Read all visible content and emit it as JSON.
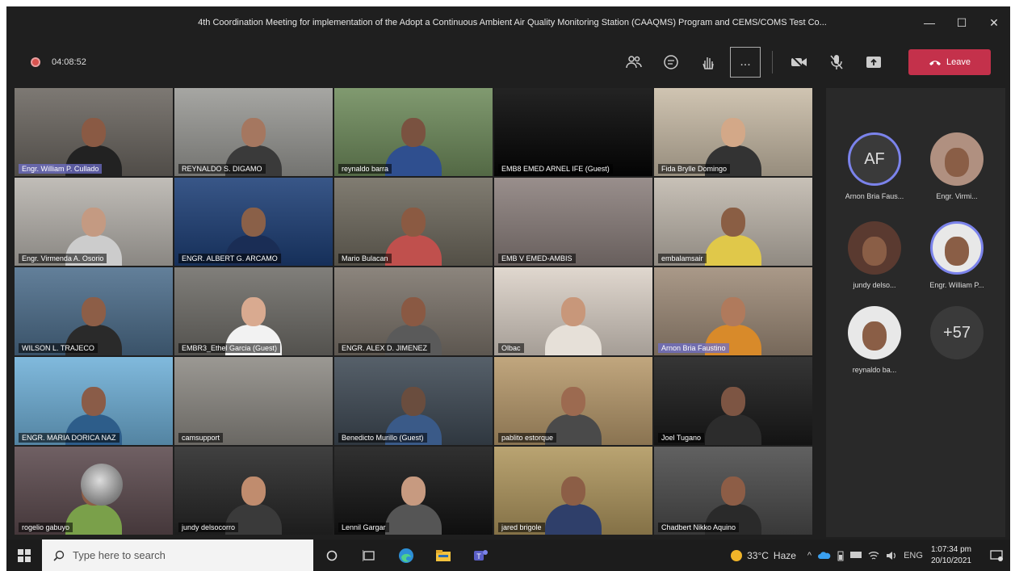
{
  "window": {
    "title": "4th Coordination Meeting for implementation of the Adopt a Continuous Ambient Air Quality Monitoring Station (CAAQMS) Program and CEMS/COMS Test Co...",
    "minimize": "—",
    "maximize": "☐",
    "close": "✕"
  },
  "toolbar": {
    "timer": "04:08:52",
    "more": "...",
    "leave_label": "Leave",
    "leave_color": "#c4314b"
  },
  "participants": [
    {
      "name": "Engr. William P. Cullado",
      "bg": "#6b6660",
      "skin": "#8a5a44",
      "shirt": "#222",
      "hl": true
    },
    {
      "name": "REYNALDO S. DIGAMO",
      "bg": "#9a9a96",
      "skin": "#a57760",
      "shirt": "#3a3a3a",
      "hl": false
    },
    {
      "name": "reynaldo barra",
      "bg": "#6f8c5c",
      "skin": "#7a5240",
      "shirt": "#2f4f8f",
      "hl": false
    },
    {
      "name": "EMB8 EMED ARNEL IFE (Guest)",
      "bg": "#050505",
      "skin": "",
      "shirt": "",
      "hl": false
    },
    {
      "name": "Fida Brylle Domingo",
      "bg": "#c9bca7",
      "skin": "#d3a888",
      "shirt": "#333",
      "hl": false
    },
    {
      "name": "Engr. Virmenda A. Osorio",
      "bg": "#b8b4ae",
      "skin": "#c49a82",
      "shirt": "#ccc",
      "hl": false
    },
    {
      "name": "ENGR. ALBERT G. ARCAMO",
      "bg": "#1d3f77",
      "skin": "#8a6048",
      "shirt": "#1a2d55",
      "hl": false
    },
    {
      "name": "Mario Bulacan",
      "bg": "#6f6a5e",
      "skin": "#8b5a42",
      "shirt": "#c0504d",
      "hl": false
    },
    {
      "name": "EMB V EMED-AMBIS",
      "bg": "#8b7f7c",
      "skin": "",
      "shirt": "",
      "hl": false
    },
    {
      "name": "embalamsair",
      "bg": "#c0b8ad",
      "skin": "#8a5e44",
      "shirt": "#e0c84a",
      "hl": false
    },
    {
      "name": "WILSON L. TRAJECO",
      "bg": "#4d6e8c",
      "skin": "#8d5e47",
      "shirt": "#2a2a2a",
      "hl": false
    },
    {
      "name": "EMBR3_Ethel Garcia (Guest)",
      "bg": "#6f6d68",
      "skin": "#d9aa90",
      "shirt": "#f2f2f2",
      "hl": false
    },
    {
      "name": "ENGR. ALEX D. JIMENEZ",
      "bg": "#7c746b",
      "skin": "#8a5943",
      "shirt": "#5a5a5a",
      "hl": false
    },
    {
      "name": "Olbac",
      "bg": "#dcd2c8",
      "skin": "#c8977a",
      "shirt": "#e6e0d8",
      "hl": false
    },
    {
      "name": "Arnon Bria Faustino",
      "bg": "#9e8b78",
      "skin": "#b07a5c",
      "shirt": "#d88a2a",
      "hl": true
    },
    {
      "name": "ENGR. MARIA DORICA NAZ",
      "bg": "#6fb0d8",
      "skin": "#8a5c48",
      "shirt": "#2d5d8a",
      "hl": false
    },
    {
      "name": "camsupport",
      "bg": "#8d8a84",
      "skin": "",
      "shirt": "",
      "hl": false
    },
    {
      "name": "Benedicto Murillo (Guest)",
      "bg": "#3f4a55",
      "skin": "#6a4d3e",
      "shirt": "#3a5a88",
      "hl": false
    },
    {
      "name": "pablito estorque",
      "bg": "#b89a6c",
      "skin": "#9c6a50",
      "shirt": "#4a4a4a",
      "hl": false
    },
    {
      "name": "Joel Tugano",
      "bg": "#1a1a1a",
      "skin": "#7d5543",
      "shirt": "#2c2c2c",
      "hl": false
    },
    {
      "name": "rogelio gabuyo",
      "bg": "#5c4a4e",
      "skin": "#8d5d45",
      "shirt": "#7aa04a",
      "hl": false
    },
    {
      "name": "jundy delsocorro",
      "bg": "#262626",
      "skin": "#c08c6e",
      "shirt": "#3a3a3a",
      "hl": false
    },
    {
      "name": "Lennil Gargar",
      "bg": "#141414",
      "skin": "#c79a80",
      "shirt": "#555",
      "hl": false
    },
    {
      "name": "jared brigole",
      "bg": "#b0975e",
      "skin": "#8c5e46",
      "shirt": "#2f3f6a",
      "hl": false
    },
    {
      "name": "Chadbert Nikko Aquino",
      "bg": "#4b4b4b",
      "skin": "#8d5d46",
      "shirt": "#2a2a2a",
      "hl": false
    }
  ],
  "side_avatars": [
    {
      "initials": "AF",
      "label": "Arnon Bria Faus...",
      "ring": true,
      "bg": "#3a3a3a"
    },
    {
      "initials": "",
      "label": "Engr. Virmi...",
      "ring": false,
      "bg": "#b09080"
    },
    {
      "initials": "",
      "label": "jundy delso...",
      "ring": false,
      "bg": "#5a3a30"
    },
    {
      "initials": "",
      "label": "Engr. William P...",
      "ring": true,
      "bg": "#e8e8e8"
    },
    {
      "initials": "",
      "label": "reynaldo ba...",
      "ring": false,
      "bg": "#e8e8e8"
    },
    {
      "initials": "+57",
      "label": "",
      "ring": false,
      "bg": "#3a3a3a"
    }
  ],
  "taskbar": {
    "search_placeholder": "Type here to search",
    "temperature": "33°C",
    "weather": "Haze",
    "language": "ENG",
    "time": "1:07:34 pm",
    "date": "20/10/2021"
  }
}
